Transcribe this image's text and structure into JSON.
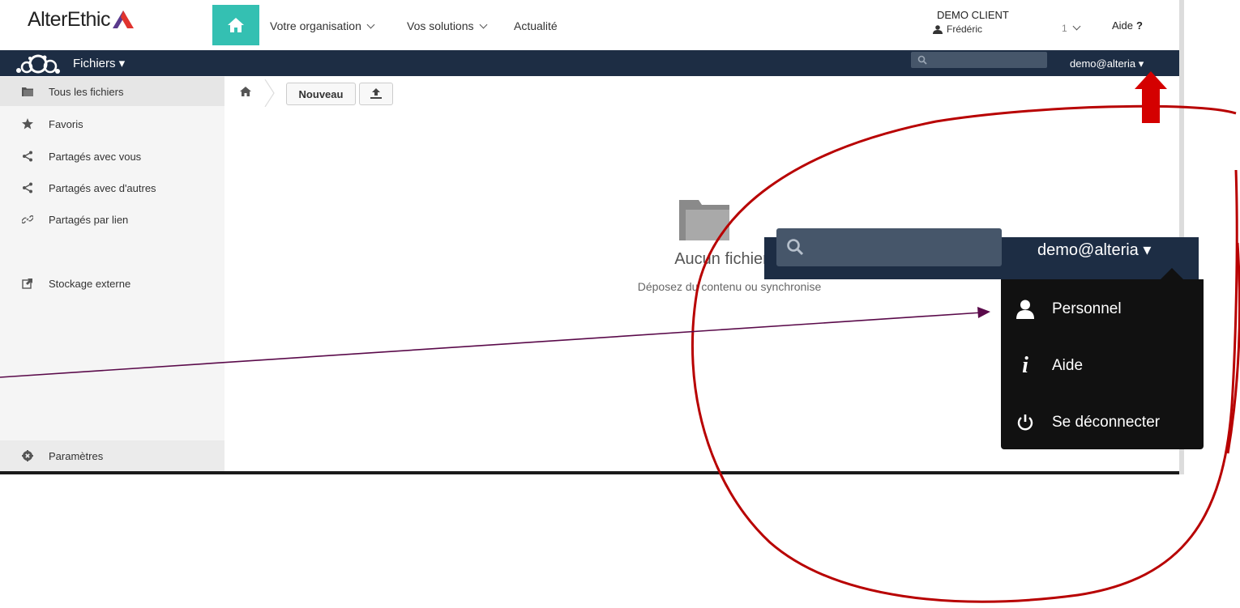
{
  "topbar": {
    "logo_text": "AlterEthic",
    "nav": [
      {
        "label": "Votre organisation"
      },
      {
        "label": "Vos solutions"
      },
      {
        "label": "Actualité"
      }
    ],
    "client_name": "DEMO CLIENT",
    "user_name": "Frédéric",
    "badge": "1",
    "help_label": "Aide",
    "help_symbol": "?",
    "accent_color": "#34c0b2"
  },
  "header": {
    "app_name": "Fichiers ▾",
    "user": "demo@alteria ▾",
    "bg_color": "#1d2d44"
  },
  "sidebar": {
    "items": [
      {
        "label": "Tous les fichiers",
        "icon": "folder-icon"
      },
      {
        "label": "Favoris",
        "icon": "star-icon"
      },
      {
        "label": "Partagés avec vous",
        "icon": "share-icon"
      },
      {
        "label": "Partagés avec d'autres",
        "icon": "share-icon"
      },
      {
        "label": "Partagés par lien",
        "icon": "link-icon"
      },
      {
        "label": "Stockage externe",
        "icon": "external-storage-icon"
      }
    ],
    "settings_label": "Paramètres"
  },
  "toolbar": {
    "new_label": "Nouveau"
  },
  "empty": {
    "title": "Aucun fichier ic",
    "subtitle": "Déposez du contenu ou synchronise"
  },
  "zoom": {
    "user": "demo@alteria ▾",
    "menu": [
      {
        "label": "Personnel",
        "icon": "person-icon"
      },
      {
        "label": "Aide",
        "icon": "info-icon"
      },
      {
        "label": "Se déconnecter",
        "icon": "power-icon"
      }
    ]
  },
  "annotation_colors": {
    "circle": "#b80000",
    "arrow_up": "#d40000",
    "pointer_line": "#5a0a4a"
  }
}
